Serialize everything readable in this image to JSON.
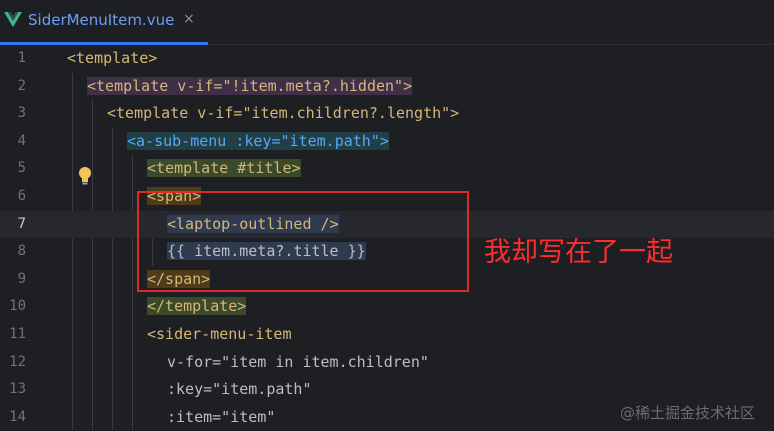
{
  "tab": {
    "title": "SiderMenuItem.vue",
    "close_glyph": "×",
    "icon": "vue-icon"
  },
  "editor": {
    "line_numbers": [
      "1",
      "2",
      "3",
      "4",
      "5",
      "6",
      "7",
      "8",
      "9",
      "10",
      "11",
      "12",
      "13",
      "14"
    ],
    "current_line": "7",
    "lines": [
      "<template>",
      "<template v-if=\"!item.meta?.hidden\">",
      "<template v-if=\"item.children?.length\">",
      "<a-sub-menu :key=\"item.path\">",
      "<template #title>",
      "<span>",
      "<laptop-outlined />",
      "{{ item.meta?.title }}",
      "</span>",
      "</template>",
      "<sider-menu-item",
      "v-for=\"item in item.children\"",
      ":key=\"item.path\"",
      ":item=\"item\""
    ]
  },
  "annotation": {
    "text": "我却写在了一起",
    "color": "#ff2d2d"
  },
  "watermark": "@稀土掘金技术社区",
  "colors": {
    "background": "#1e1f22",
    "accent": "#3574f0",
    "tag": "#d5b778",
    "string": "#6aab73",
    "keyword": "#c77dbb"
  }
}
